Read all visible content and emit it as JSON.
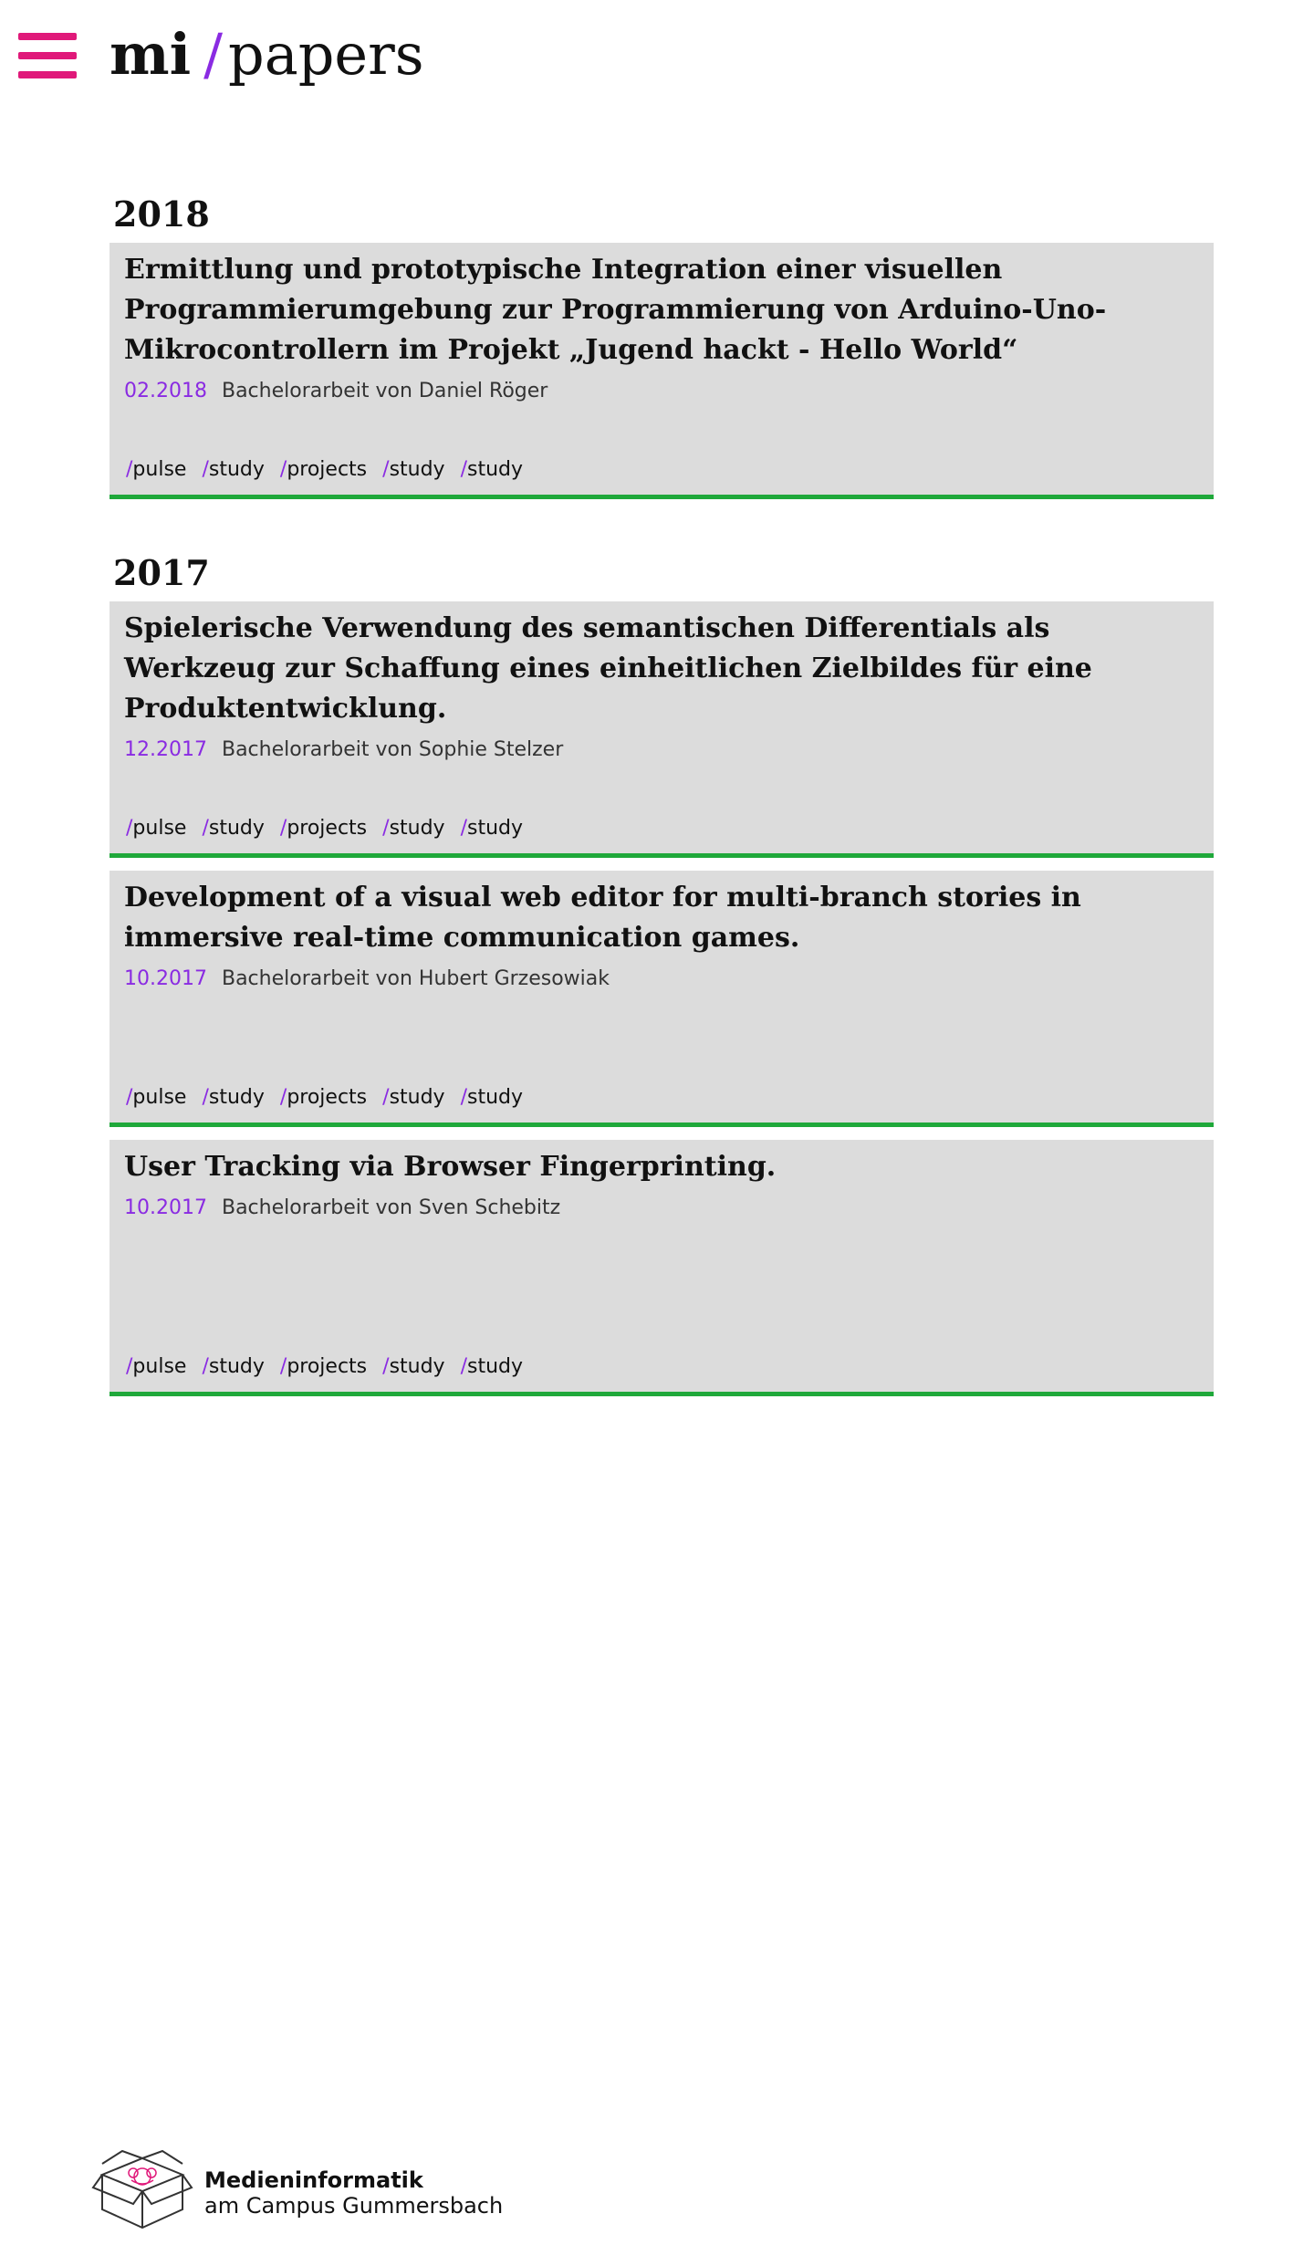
{
  "header": {
    "logo_mi": "mi",
    "logo_slash": "/",
    "logo_papers": "papers"
  },
  "years": [
    {
      "year": "2018",
      "papers": [
        {
          "title": "Ermittlung und prototypische Integration einer visuellen Programmierumgebung zur Programmierung von Arduino-Uno-Mikrocontrollern im Projekt „Jugend hackt - Hello World“",
          "date": "02.2018",
          "type_author": "Bachelorarbeit von Daniel Röger",
          "tags": [
            "pulse",
            "study",
            "projects",
            "study",
            "study"
          ]
        }
      ]
    },
    {
      "year": "2017",
      "papers": [
        {
          "title": "Spielerische Verwendung des semantischen Differentials als Werkzeug zur Schaffung eines einheitlichen Zielbildes für eine Produktentwicklung.",
          "date": "12.2017",
          "type_author": "Bachelorarbeit von Sophie Stelzer",
          "tags": [
            "pulse",
            "study",
            "projects",
            "study",
            "study"
          ]
        },
        {
          "title": "Development of a visual web editor for multi-branch stories in immersive real-time communication games.",
          "date": "10.2017",
          "type_author": "Bachelorarbeit von Hubert Grzesowiak",
          "tags": [
            "pulse",
            "study",
            "projects",
            "study",
            "study"
          ]
        },
        {
          "title": "User Tracking via Browser Fingerprinting.",
          "date": "10.2017",
          "type_author": "Bachelorarbeit von Sven Schebitz",
          "tags": [
            "pulse",
            "study",
            "projects",
            "study",
            "study"
          ]
        }
      ]
    }
  ],
  "tag_prefix": "/",
  "footer": {
    "line1": "Medieninformatik",
    "line2": "am Campus Gummersbach"
  },
  "colors": {
    "menu_accent": "#e0197a",
    "slash_accent": "#8a2be2",
    "card_border": "#1fa83a",
    "card_background": "#dcdcdc"
  },
  "icons": {
    "menu": "hamburger-menu-icon",
    "footer_logo": "campus-box-logo"
  }
}
